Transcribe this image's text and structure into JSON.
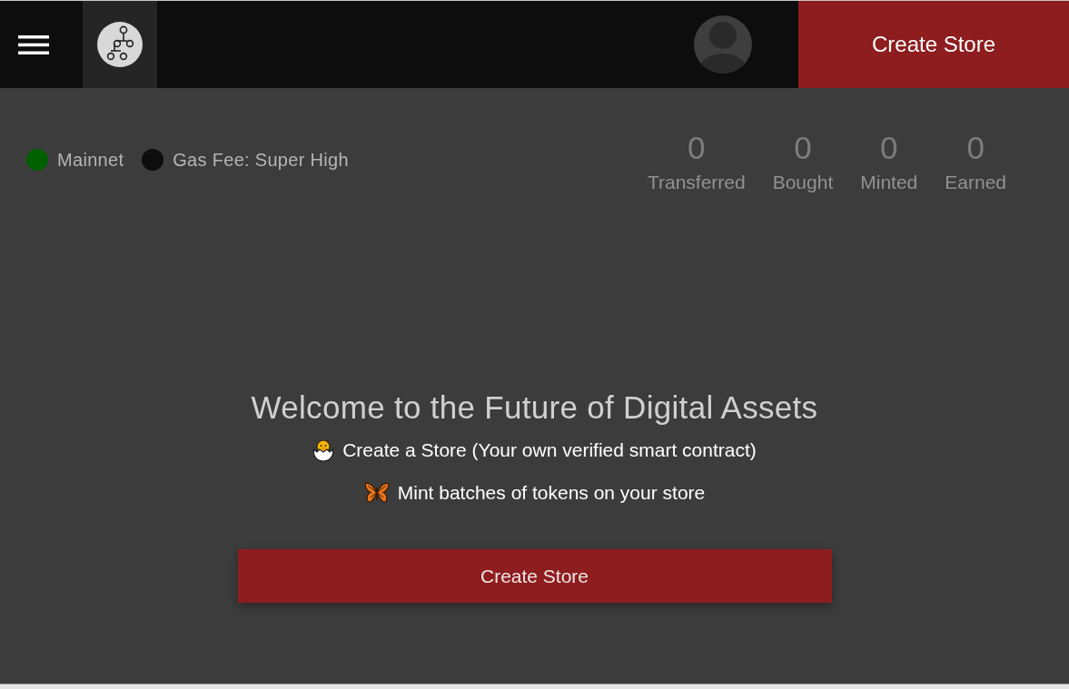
{
  "header": {
    "create_store_button": "Create Store"
  },
  "network": [
    {
      "label": "Mainnet",
      "color": "#006000"
    },
    {
      "label": "Gas Fee: Super High",
      "color": "#0d0d0d"
    }
  ],
  "stats": [
    {
      "value": "0",
      "label": "Transferred"
    },
    {
      "value": "0",
      "label": "Bought"
    },
    {
      "value": "0",
      "label": "Minted"
    },
    {
      "value": "0",
      "label": "Earned"
    }
  ],
  "welcome": {
    "title": "Welcome to the Future of Digital Assets",
    "features": [
      {
        "kind": "chick",
        "text": "Create a Store (Your own verified smart contract)"
      },
      {
        "kind": "butterfly",
        "text": "Mint batches of tokens on your store"
      }
    ],
    "button": "Create Store"
  }
}
